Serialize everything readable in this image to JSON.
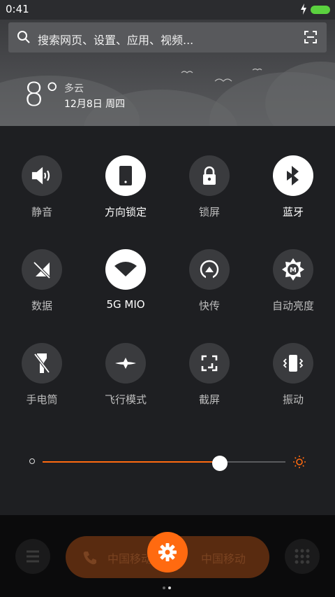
{
  "status": {
    "time": "0:41"
  },
  "search": {
    "placeholder": "搜索网页、设置、应用、视频..."
  },
  "weather": {
    "temp": "8°",
    "condition": "多云",
    "date": "12月8日 周四"
  },
  "tiles": [
    {
      "label": "静音",
      "active": false
    },
    {
      "label": "方向锁定",
      "active": true
    },
    {
      "label": "锁屏",
      "active": false
    },
    {
      "label": "蓝牙",
      "active": true
    },
    {
      "label": "数据",
      "active": false
    },
    {
      "label": "5G    MIO",
      "active": true
    },
    {
      "label": "快传",
      "active": false
    },
    {
      "label": "自动亮度",
      "active": false
    },
    {
      "label": "手电筒",
      "active": false
    },
    {
      "label": "飞行模式",
      "active": false
    },
    {
      "label": "截屏",
      "active": false
    },
    {
      "label": "振动",
      "active": false
    }
  ],
  "brightness": {
    "level": 0.73
  },
  "bottom": {
    "carrier1": "中国移动",
    "carrier2": "中国移动"
  },
  "colors": {
    "accent": "#ff6a10",
    "battery": "#5bd13f"
  }
}
